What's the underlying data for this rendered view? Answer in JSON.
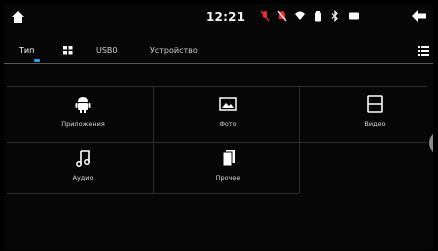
{
  "status": {
    "time": "12:21",
    "icons": [
      "mic-off-icon",
      "bell-off-icon",
      "wifi-icon",
      "battery-icon",
      "bluetooth-icon",
      "screen-icon"
    ]
  },
  "tabs": {
    "type_label": "Тип",
    "grid_icon": "grid-icon",
    "usb_label": "USB0",
    "device_label": "Устройство"
  },
  "colors": {
    "accent": "#2aa0ea",
    "background": "#060606",
    "divider": "#2f2f2f"
  },
  "items": [
    {
      "label": "Приложения",
      "icon": "android-icon"
    },
    {
      "label": "Фото",
      "icon": "photo-icon"
    },
    {
      "label": "Видео",
      "icon": "video-icon"
    },
    {
      "label": "Аудио",
      "icon": "music-note-icon"
    },
    {
      "label": "Прочее",
      "icon": "files-icon"
    }
  ]
}
